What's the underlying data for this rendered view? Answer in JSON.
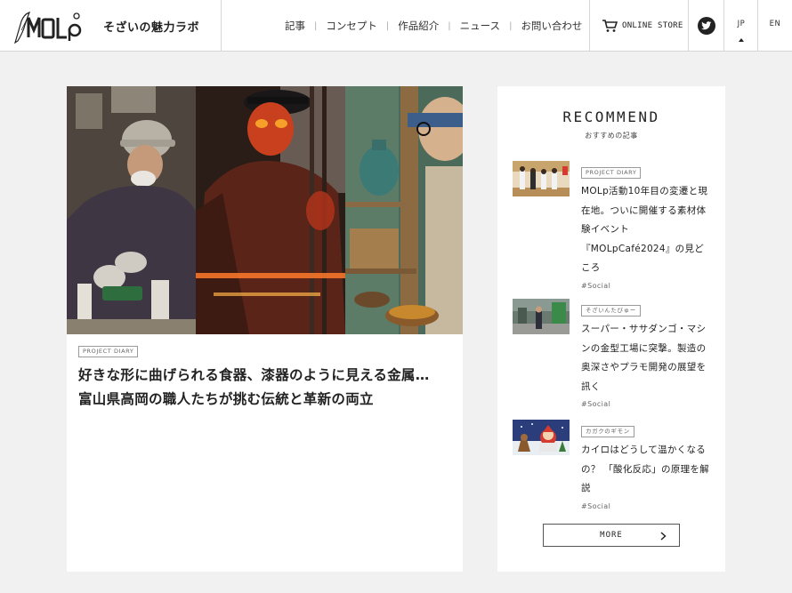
{
  "header": {
    "logo_alt": "MOLp",
    "tagline": "そざいの魅力ラボ",
    "nav": [
      "記事",
      "コンセプト",
      "作品紹介",
      "ニュース",
      "お問い合わせ"
    ],
    "nav_separator": "|",
    "store_label": "ONLINE STORE",
    "languages": {
      "jp": "JP",
      "en": "EN"
    },
    "icons": {
      "cart": "cart-icon",
      "twitter": "twitter-icon"
    }
  },
  "feature": {
    "tag": "PROJECT DIARY",
    "title_line1": "好きな形に曲げられる食器、漆器のように見える金属…",
    "title_line2": "富山県高岡の職人たちが挑む伝統と革新の両立"
  },
  "recommend": {
    "heading": "RECOMMEND",
    "subheading": "おすすめの記事",
    "items": [
      {
        "tag": "PROJECT DIARY",
        "title": "MOLp活動10年目の変遷と現在地。ついに開催する素材体験イベント『MOLpCafé2024』の見どころ",
        "hashtag": "#Social"
      },
      {
        "tag": "そざいんたびゅー",
        "title": "スーパー・ササダンゴ・マシンの金型工場に突撃。製造の奥深さやプラモ開発の展望を訊く",
        "hashtag": "#Social"
      },
      {
        "tag": "カガクのギモン",
        "title": "カイロはどうして温かくなるの？ 「酸化反応」の原理を解説",
        "hashtag": "#Social"
      }
    ],
    "more_label": "MORE"
  },
  "colors": {
    "text": "#222222",
    "background": "#f1f1f1",
    "card": "#ffffff",
    "border": "#d6d6d6"
  }
}
